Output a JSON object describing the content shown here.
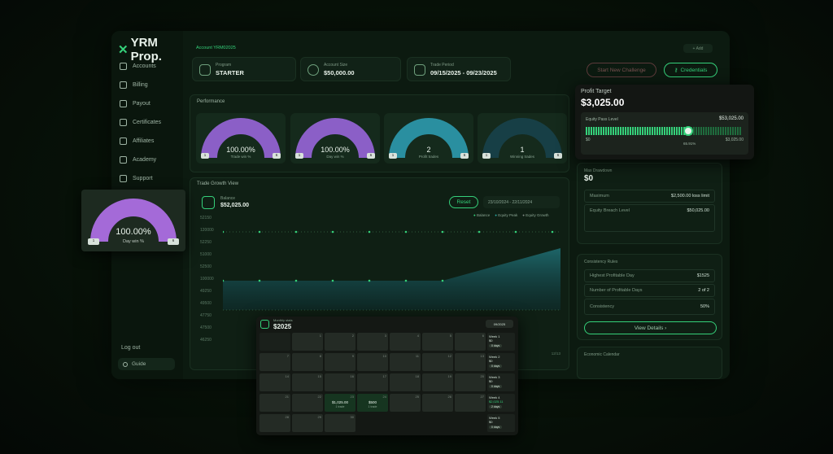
{
  "brand": {
    "name": "YRM Prop."
  },
  "sidebar": {
    "items": [
      {
        "label": "Accounts",
        "icon": "users-icon"
      },
      {
        "label": "Billing",
        "icon": "wallet-icon"
      },
      {
        "label": "Payout",
        "icon": "payout-icon"
      },
      {
        "label": "Certificates",
        "icon": "certificate-icon"
      },
      {
        "label": "Affiliates",
        "icon": "affiliates-icon"
      },
      {
        "label": "Academy",
        "icon": "monitor-icon"
      },
      {
        "label": "Support",
        "icon": "support-icon"
      }
    ],
    "logout": "Log out",
    "guide": "Guide"
  },
  "header": {
    "account": "Account YRM02025",
    "add_label": "+ Add"
  },
  "info_cards": [
    {
      "label": "Program",
      "value": "STARTER"
    },
    {
      "label": "Account Size",
      "value": "$50,000.00"
    },
    {
      "label": "Trade Period",
      "value": "09/15/2025 - 09/23/2025"
    }
  ],
  "actions": {
    "start_challenge": "Start New Challenge",
    "credentials": "Credentials"
  },
  "performance": {
    "title": "Performance",
    "gauges": [
      {
        "value": "100.00%",
        "label": "Trade win %",
        "min": "1",
        "max": "6",
        "fill": 1.0,
        "color": "#8b5fc7"
      },
      {
        "value": "100.00%",
        "label": "Day win %",
        "min": "1",
        "max": "6",
        "fill": 1.0,
        "color": "#8b5fc7"
      },
      {
        "value": "2",
        "label": "Profit trades",
        "min": "1",
        "max": "6",
        "fill": 1.0,
        "color": "#2a8fa0"
      },
      {
        "value": "1",
        "label": "Winning trades",
        "min": "1",
        "max": "6",
        "fill": 1.0,
        "color": "#173f46"
      }
    ]
  },
  "trade_growth": {
    "title": "Trade Growth View",
    "balance_label": "Balance",
    "balance_value": "$52,025.00",
    "reset_label": "Reset",
    "date_range": "23/10/2024 - 22/11/2024",
    "legend": [
      "Balance",
      "Equity Peak",
      "Equity Growth"
    ],
    "y_ticks": [
      "52150",
      "120000",
      "52250",
      "51000",
      "52500",
      "100000",
      "49250",
      "49500",
      "47750",
      "47500",
      "46250"
    ],
    "x_last": "12/13"
  },
  "float_gauge": {
    "value": "100.00%",
    "label": "Day win %",
    "min": "1",
    "max": "6",
    "fill": 1.0,
    "color": "#a46ad8"
  },
  "profit_target": {
    "title": "Profit Target",
    "value": "$3,025.00",
    "bar_label": "Equity Pass Level",
    "bar_right": "$53,025.00",
    "min": "$0",
    "pct": "65.91%",
    "max": "$3,025.00",
    "fill": 0.6591
  },
  "max_drawdown": {
    "title": "Max Drawdown",
    "value": "$0",
    "rows": [
      {
        "label": "Maximum",
        "value": "$2,500.00 loss limit"
      },
      {
        "label": "Equity Breach Level",
        "value": "$50,025.00"
      }
    ]
  },
  "consistency": {
    "title": "Consistency Rules",
    "rows": [
      {
        "label": "Highest Profitable Day",
        "value": "$1525"
      },
      {
        "label": "Number of Profitable Days",
        "value": "2 of 2"
      },
      {
        "label": "Consistency",
        "value": "50%"
      }
    ],
    "view_details": "View Details ›"
  },
  "economic_calendar": {
    "title": "Economic Calendar"
  },
  "calendar": {
    "title": "Monthly stats",
    "value": "$2025",
    "month": "09/2025",
    "weeks": [
      {
        "label": "Week 1",
        "amount": "$0",
        "days": "0 days"
      },
      {
        "label": "Week 2",
        "amount": "$0",
        "days": "0 days"
      },
      {
        "label": "Week 3",
        "amount": "$0",
        "days": "0 days"
      },
      {
        "label": "Week 4",
        "amount": "$2,025.11",
        "days": "2 days"
      },
      {
        "label": "Week 5",
        "amount": "$0",
        "days": "0 days"
      }
    ],
    "green_cells": [
      {
        "amount": "$1,025.00",
        "sub": "1 trade"
      },
      {
        "amount": "$500",
        "sub": "1 trade"
      }
    ]
  }
}
